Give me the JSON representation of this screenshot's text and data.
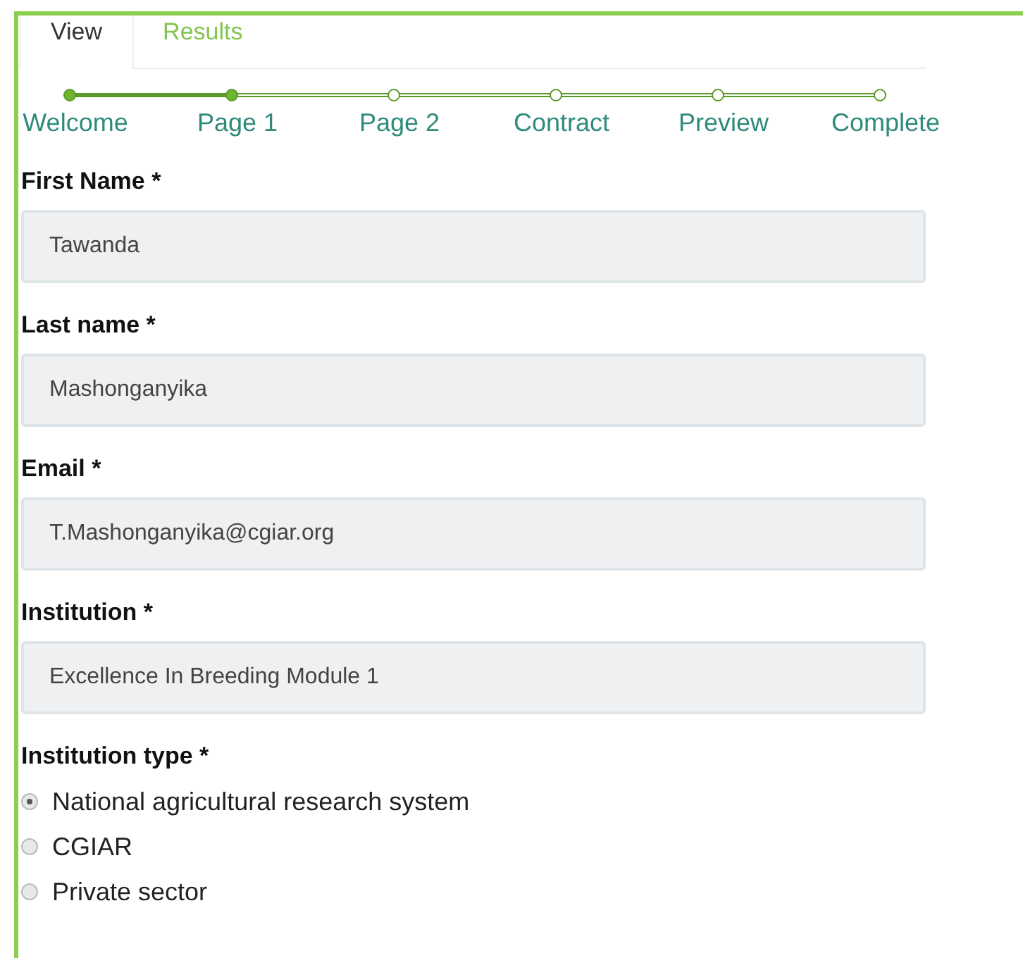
{
  "tabs": [
    {
      "label": "View",
      "selected": true
    },
    {
      "label": "Results",
      "selected": false
    }
  ],
  "steps": [
    {
      "label": "Welcome",
      "done": true
    },
    {
      "label": "Page 1",
      "done": true
    },
    {
      "label": "Page 2",
      "done": false
    },
    {
      "label": "Contract",
      "done": false
    },
    {
      "label": "Preview",
      "done": false
    },
    {
      "label": "Complete",
      "done": false
    }
  ],
  "fields": [
    {
      "label": "First Name *",
      "value": "Tawanda"
    },
    {
      "label": "Last name *",
      "value": "Mashonganyika"
    },
    {
      "label": "Email *",
      "value": "T.Mashonganyika@cgiar.org"
    },
    {
      "label": "Institution *",
      "value": "Excellence In Breeding Module 1"
    }
  ],
  "institution_type": {
    "label": "Institution type *",
    "options": [
      {
        "label": "National agricultural research system",
        "selected": true
      },
      {
        "label": "CGIAR",
        "selected": false
      },
      {
        "label": "Private sector",
        "selected": false
      }
    ]
  }
}
